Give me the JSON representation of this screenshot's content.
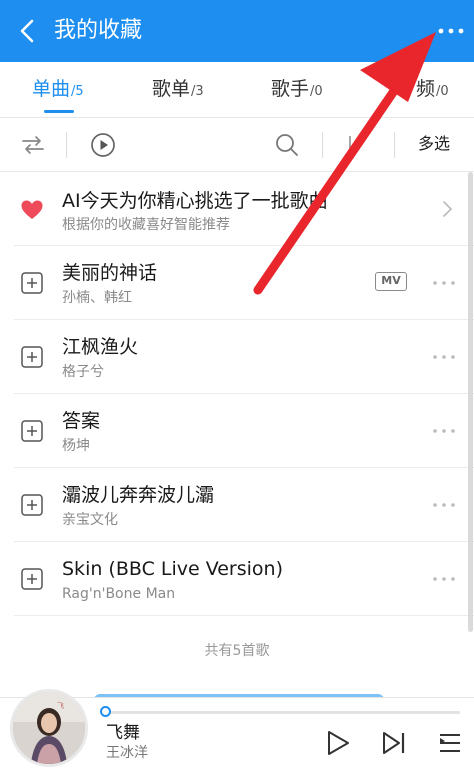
{
  "header": {
    "title": "我的收藏",
    "back_icon": "chevron-left-icon",
    "more_icon": "more-horizontal-icon",
    "bg_color": "#1e8ff0"
  },
  "tabs": [
    {
      "label": "单曲",
      "count": "/5",
      "active": true
    },
    {
      "label": "歌单",
      "count": "/3",
      "active": false
    },
    {
      "label": "歌手",
      "count": "/0",
      "active": false
    },
    {
      "label": "频",
      "count": "/0",
      "active": false
    }
  ],
  "toolbar": {
    "multi_select_label": "多选",
    "icons": [
      "shuffle-icon",
      "play-circle-icon",
      "search-icon"
    ]
  },
  "recommendation": {
    "title": "AI今天为你精心挑选了一批歌曲",
    "subtitle": "根据你的收藏喜好智能推荐",
    "icon": "heart-icon"
  },
  "songs": [
    {
      "title": "美丽的神话",
      "artist": "孙楠、韩红",
      "badge": "MV"
    },
    {
      "title": "江枫渔火",
      "artist": "格子兮"
    },
    {
      "title": "答案",
      "artist": "杨坤"
    },
    {
      "title": "灞波儿奔奔波儿灞",
      "artist": "亲宝文化"
    },
    {
      "title": "Skin (BBC Live Version)",
      "artist": "Rag'n'Bone Man"
    }
  ],
  "summary": "共有5首歌",
  "player": {
    "song": "飞舞",
    "artist": "王冰洋",
    "progress": 0.0
  },
  "annotation": {
    "color": "#e8262b"
  }
}
